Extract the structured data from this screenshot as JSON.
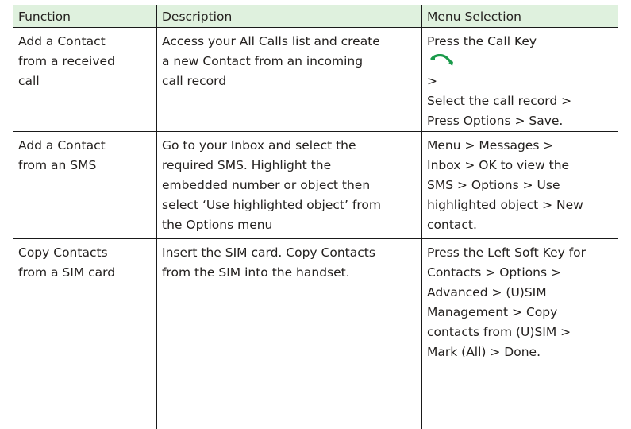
{
  "table": {
    "headers": [
      "Function",
      "Description",
      "Menu Selection"
    ],
    "rows": [
      {
        "function": [
          "Add a Contact",
          "from a received",
          "call"
        ],
        "description": [
          "Access your All Calls list and create",
          "a new Contact from an incoming",
          "call record"
        ],
        "menu": {
          "first_line_before_icon": "Press the Call Key",
          "first_line_after_icon": ">",
          "lines": [
            "Select the call record >",
            "Press Options > Save."
          ]
        }
      },
      {
        "function": [
          "Add a Contact",
          "from an SMS"
        ],
        "description": [
          "Go to your Inbox and select the",
          "required SMS. Highlight the",
          "embedded number or object then",
          "select ‘Use highlighted object’ from",
          "the Options menu"
        ],
        "menu": [
          "Menu > Messages >",
          "Inbox > OK to view the",
          "SMS > Options > Use",
          "highlighted object > New",
          "contact."
        ]
      },
      {
        "function": [
          "Copy Contacts",
          "from a SIM card"
        ],
        "description": [
          "Insert the SIM card. Copy Contacts",
          "from the SIM into the handset."
        ],
        "menu": [
          "Press the Left Soft Key for",
          "Contacts > Options >",
          "Advanced > (U)SIM",
          "Management > Copy",
          "contacts from (U)SIM >",
          "Mark (All) > Done."
        ]
      }
    ]
  },
  "icons": {
    "call_key": "phone-handset-icon"
  },
  "colors": {
    "header_bg": "#dff1de",
    "call_key_green": "#1a9a4a",
    "text": "#24211f",
    "rule": "#1a1a1a"
  }
}
